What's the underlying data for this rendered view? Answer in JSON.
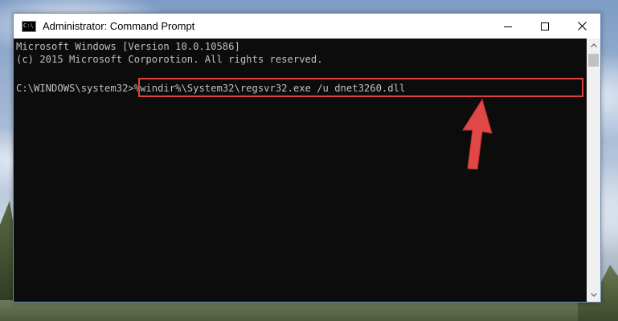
{
  "window": {
    "title": "Administrator: Command Prompt",
    "app_icon_text": "C:\\"
  },
  "console": {
    "line1": "Microsoft Windows [Version 10.0.10586]",
    "line2": "(c) 2015 Microsoft Corporotion. All rights reserved.",
    "prompt": "C:\\WINDOWS\\system32>",
    "command": "%windir%\\System32\\regsvr32.exe /u dnet3260.dll"
  },
  "colors": {
    "console_bg": "#0c0c0c",
    "console_text": "#c0c0c0",
    "highlight": "#e04040"
  },
  "icons": {
    "minimize": "minimize-icon",
    "maximize": "maximize-icon",
    "close": "close-icon",
    "annotation": "red-arrow-icon"
  }
}
